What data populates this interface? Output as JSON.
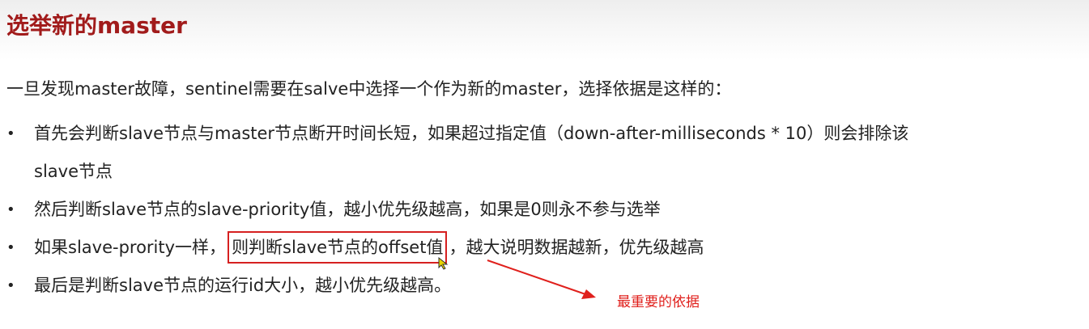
{
  "slide": {
    "title": "选举新的master",
    "intro": "一旦发现master故障，sentinel需要在salve中选择一个作为新的master，选择依据是这样的：",
    "bullets": [
      {
        "line1": "首先会判断slave节点与master节点断开时间长短，如果超过指定值（down-after-milliseconds * 10）则会排除该",
        "line2": "slave节点"
      },
      {
        "text": "然后判断slave节点的slave-priority值，越小优先级越高，如果是0则永不参与选举"
      },
      {
        "before": "如果slave-prority一样，",
        "highlighted": "则判断slave节点的offset值",
        "after": "，越大说明数据越新，优先级越高"
      },
      {
        "text": "最后是判断slave节点的运行id大小，越小优先级越高。"
      }
    ],
    "bullet_symbol": "•",
    "annotation": "最重要的依据"
  },
  "colors": {
    "title": "#a11b1b",
    "highlight_border": "#d62020",
    "annotation": "#e0201c"
  },
  "icons": [
    "mouse-cursor-icon",
    "arrow-icon"
  ]
}
